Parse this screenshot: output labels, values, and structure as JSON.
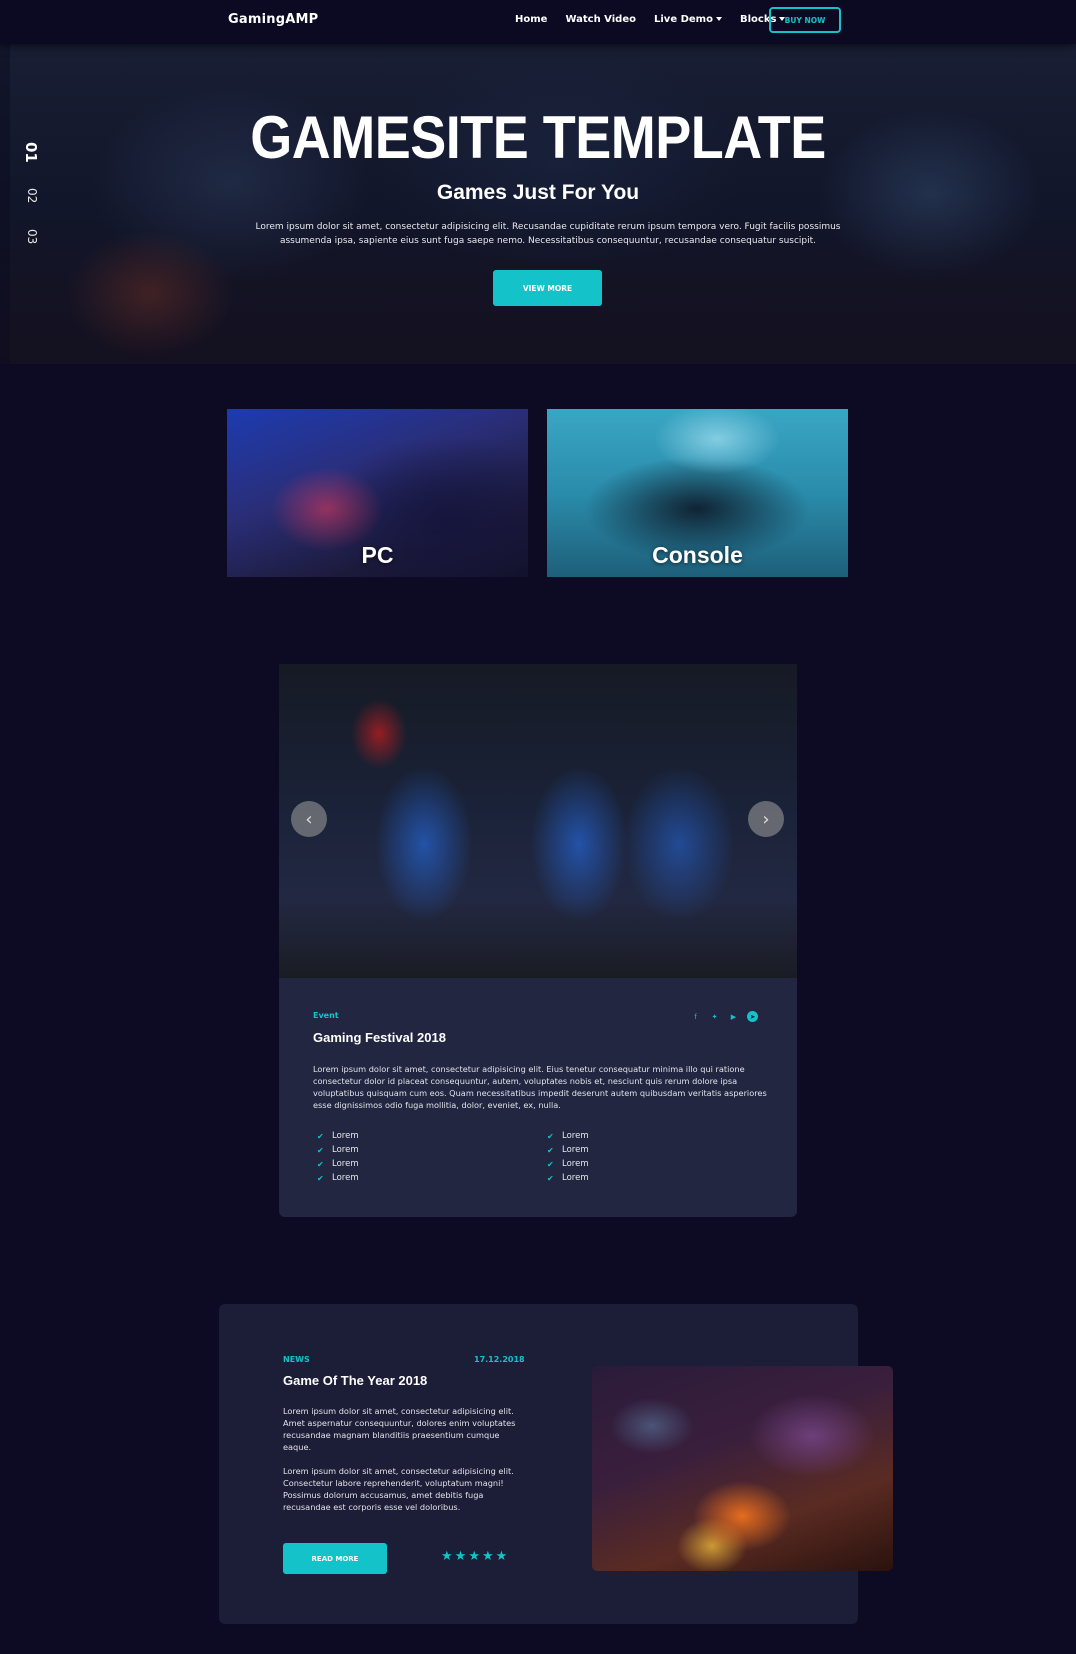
{
  "nav": {
    "brand": "GamingAMP",
    "links": [
      "Home",
      "Watch Video",
      "Live Demo",
      "Blocks"
    ],
    "buy_now": "BUY NOW"
  },
  "hero": {
    "slides": [
      "01",
      "02",
      "03"
    ],
    "title": "GAMESITE TEMPLATE",
    "subtitle": "Games Just For You",
    "text": "Lorem ipsum dolor sit amet, consectetur adipisicing elit. Recusandae cupiditate rerum ipsum tempora vero. Fugit facilis possimus assumenda ipsa, sapiente eius sunt fuga saepe nemo. Necessitatibus consequuntur, recusandae consequatur suscipit.",
    "button": "VIEW MORE"
  },
  "categories": [
    "PC",
    "Console"
  ],
  "event": {
    "tag": "Event",
    "title": "Gaming Festival 2018",
    "text": "Lorem ipsum dolor sit amet, consectetur adipisicing elit. Eius tenetur consequatur minima illo qui ratione consectetur dolor id placeat consequuntur, autem, voluptates nobis et, nesciunt quis rerum dolore ipsa voluptatibus quisquam cum eos. Quam necessitatibus impedit deserunt autem quibusdam veritatis asperiores esse dignissimos odio fuga mollitia, dolor, eveniet, ex, nulla.",
    "list_left": [
      "Lorem",
      "Lorem",
      "Lorem",
      "Lorem"
    ],
    "list_right": [
      "Lorem",
      "Lorem",
      "Lorem",
      "Lorem"
    ],
    "social_icons": [
      "facebook-icon",
      "twitter-icon",
      "youtube-icon",
      "telegram-icon"
    ]
  },
  "news": {
    "tag": "NEWS",
    "date": "17.12.2018",
    "title": "Game Of The Year 2018",
    "p1": "Lorem ipsum dolor sit amet, consectetur adipisicing elit. Amet aspernatur consequuntur, dolores enim voluptates recusandae magnam blanditiis praesentium cumque eaque.",
    "p2": "Lorem ipsum dolor sit amet, consectetur adipisicing elit. Consectetur labore reprehenderit, voluptatum magni! Possimus dolorum accusamus, amet debitis fuga recusandae est corporis esse vel doloribus.",
    "button": "READ MORE",
    "rating": 5,
    "rating_max": 5
  },
  "colors": {
    "background": "#0d0b24",
    "accent": "#14c3c9",
    "card": "#222641",
    "news_card": "#1c1d36"
  }
}
